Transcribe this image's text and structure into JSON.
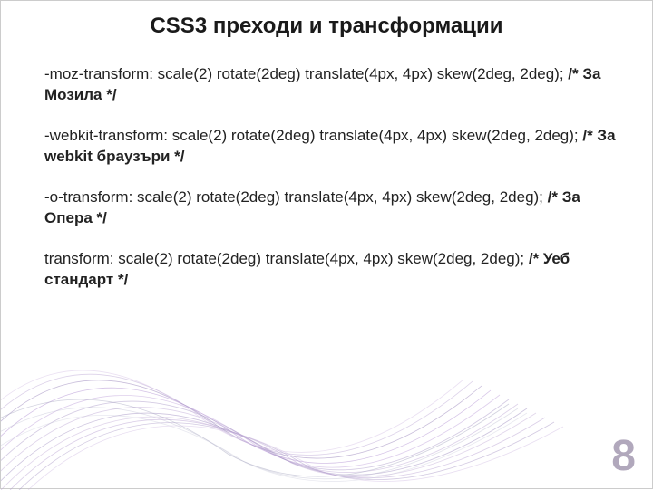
{
  "title": "CSS3 преходи и трансформации",
  "paragraphs": [
    {
      "code": "-moz-transform: scale(2) rotate(2deg) translate(4px, 4px) skew(2deg, 2deg);",
      "comment": "/* За Мозила */"
    },
    {
      "code": "-webkit-transform: scale(2) rotate(2deg) translate(4px, 4px) skew(2deg, 2deg);",
      "comment": "/* За webkit браузъри */"
    },
    {
      "code": "-o-transform: scale(2) rotate(2deg) translate(4px, 4px) skew(2deg, 2deg);",
      "comment": "/* За Опера */"
    },
    {
      "code": "transform: scale(2) rotate(2deg) translate(4px, 4px) skew(2deg, 2deg);",
      "comment": "/* Уеб стандарт */"
    }
  ],
  "logo": "8"
}
